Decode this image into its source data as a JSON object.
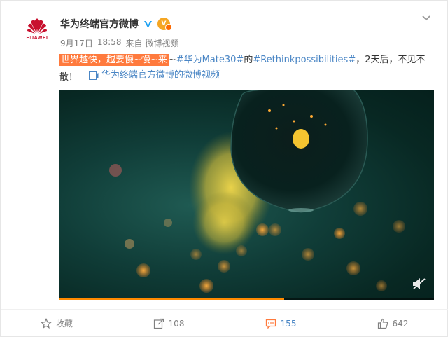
{
  "post": {
    "brand_text": "HUAWEI",
    "author": "华为终端官方微博",
    "vip_label": "V",
    "date": "9月17日",
    "time": "18:58",
    "source": "来自 微博视频",
    "text_highlight": "世界越快，越要慢~慢~来",
    "text_tilde": "~",
    "topic_mate": "#华为Mate30#",
    "text_de": "的",
    "topic_rethink": "#Rethinkpossibilities#",
    "text_tail": "，2天后，不见不散！",
    "video_link": "华为终端官方微博的微博视频"
  },
  "video": {
    "progress_percent": 60
  },
  "actions": {
    "favorite_label": "收藏",
    "repost_count": "108",
    "comment_count": "155",
    "like_count": "642"
  },
  "colors": {
    "accent": "#ff7a3d",
    "link": "#4a86c5",
    "progress": "#ff8a00",
    "brand_red": "#c8102e"
  }
}
